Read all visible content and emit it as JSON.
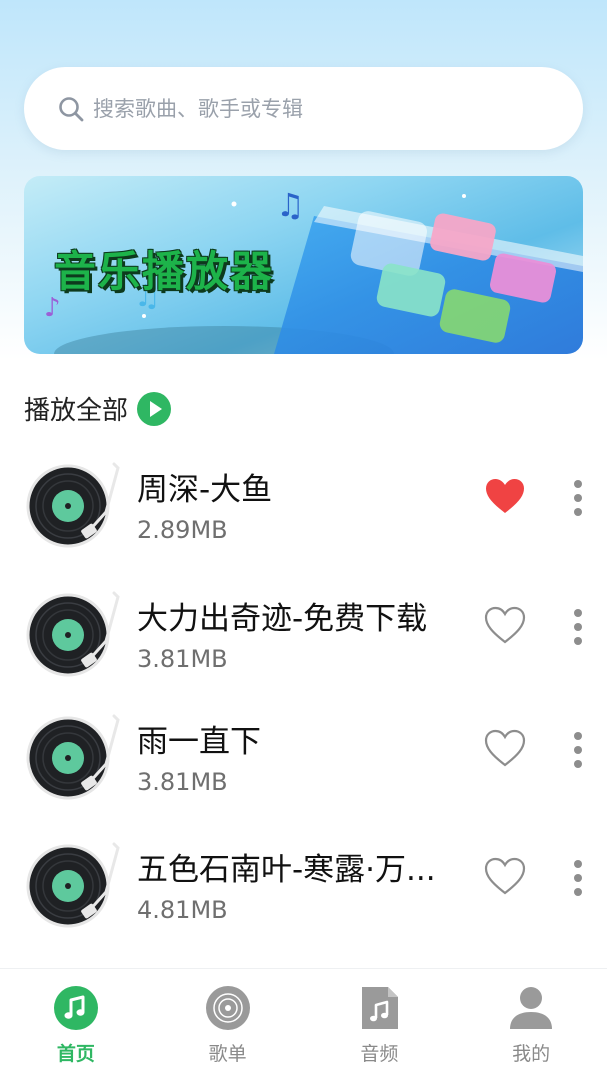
{
  "search": {
    "placeholder": "搜索歌曲、歌手或专辑"
  },
  "banner": {
    "title": "音乐播放器"
  },
  "play_all": {
    "label": "播放全部"
  },
  "songs": [
    {
      "name": "周深-大鱼",
      "size": "2.89MB",
      "liked": true
    },
    {
      "name": "大力出奇迹-免费下载",
      "size": "3.81MB",
      "liked": false
    },
    {
      "name": "雨一直下",
      "size": "3.81MB",
      "liked": false
    },
    {
      "name": "五色石南叶-寒露·万...",
      "size": "4.81MB",
      "liked": false
    }
  ],
  "tabs": [
    {
      "label": "首页",
      "icon": "music-note-icon",
      "active": true
    },
    {
      "label": "歌单",
      "icon": "vinyl-icon",
      "active": false
    },
    {
      "label": "音频",
      "icon": "audio-file-icon",
      "active": false
    },
    {
      "label": "我的",
      "icon": "user-icon",
      "active": false
    }
  ],
  "colors": {
    "accent": "#2fb763",
    "liked": "#f04343",
    "inactive": "#8a8a8a"
  }
}
